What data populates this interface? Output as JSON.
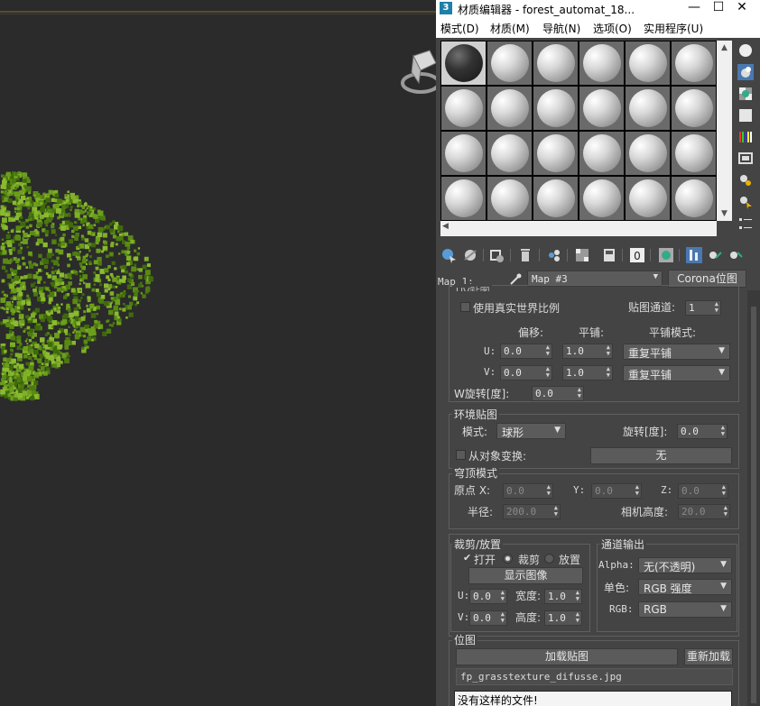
{
  "window": {
    "title": "材质编辑器 - forest_automat_18...",
    "app_icon": "3",
    "minimize": "—",
    "maximize": "☐",
    "close": "✕"
  },
  "menu": [
    "模式(D)",
    "材质(M)",
    "导航(N)",
    "选项(O)",
    "实用程序(U)"
  ],
  "map": {
    "label": "Map 1:",
    "dropdown_value": "Map #3",
    "type_button": "Corona位图"
  },
  "coords": {
    "partial_header": "UV贴图",
    "real_world_label": "使用真实世界比例",
    "channel_label": "贴图通道:",
    "channel_value": "1",
    "offset_header": "偏移:",
    "tiling_header": "平铺:",
    "tile_mode_header": "平铺模式:",
    "u_label": "U:",
    "v_label": "V:",
    "u_offset": "0.0",
    "v_offset": "0.0",
    "u_tiling": "1.0",
    "v_tiling": "1.0",
    "u_mode": "重复平铺",
    "v_mode": "重复平铺",
    "w_rotation_label": "W旋转[度]:",
    "w_rotation_value": "0.0"
  },
  "env": {
    "header": "环境贴图",
    "mode_label": "模式:",
    "mode_value": "球形",
    "rotation_label": "旋转[度]:",
    "rotation_value": "0.0",
    "from_object_label": "从对象变换:",
    "object_button": "无"
  },
  "dome": {
    "header": "穹顶模式",
    "origin_label": "原点 X:",
    "x_value": "0.0",
    "y_label": "Y:",
    "y_value": "0.0",
    "z_label": "Z:",
    "z_value": "0.0",
    "radius_label": "半径:",
    "radius_value": "200.0",
    "camera_height_label": "相机高度:",
    "camera_height_value": "20.0"
  },
  "crop": {
    "header": "裁剪/放置",
    "on_label": "打开",
    "crop_label": "裁剪",
    "place_label": "放置",
    "view_image_button": "显示图像",
    "u_label": "U:",
    "u_value": "0.0",
    "width_label": "宽度:",
    "width_value": "1.0",
    "v_label": "V:",
    "v_value": "0.0",
    "height_label": "高度:",
    "height_value": "1.0"
  },
  "channel_output": {
    "header": "通道输出",
    "alpha_label": "Alpha:",
    "alpha_value": "无(不透明)",
    "mono_label": "单色:",
    "mono_value": "RGB 强度",
    "rgb_label": "RGB:",
    "rgb_value": "RGB"
  },
  "bitmap": {
    "header": "位图",
    "load_button": "加载贴图",
    "reload_button": "重新加载",
    "file_name": "fp_grasstexture_difusse.jpg",
    "error_text": "没有这样的文件!"
  },
  "colors": {
    "viewport_bg": "#2b2b2b",
    "panel_bg": "#444444",
    "foliage": "#5a8a14",
    "accent_blue": "#3c8fd6"
  },
  "icons": {
    "sidebar": [
      "sample-type-icon",
      "backlight-icon",
      "background-icon",
      "uv-tiling-icon",
      "video-check-icon",
      "make-preview-icon",
      "options-icon",
      "select-by-material-icon",
      "material-map-navigator-icon"
    ],
    "toolbar": [
      "get-material-icon",
      "put-to-scene-icon",
      "assign-to-selection-icon",
      "reset-map-icon",
      "make-unique-icon",
      "put-to-library-icon",
      "material-id-channel-icon",
      "show-shaded-icon",
      "show-end-result-icon",
      "go-to-parent-icon",
      "go-forward-sibling-icon"
    ]
  }
}
